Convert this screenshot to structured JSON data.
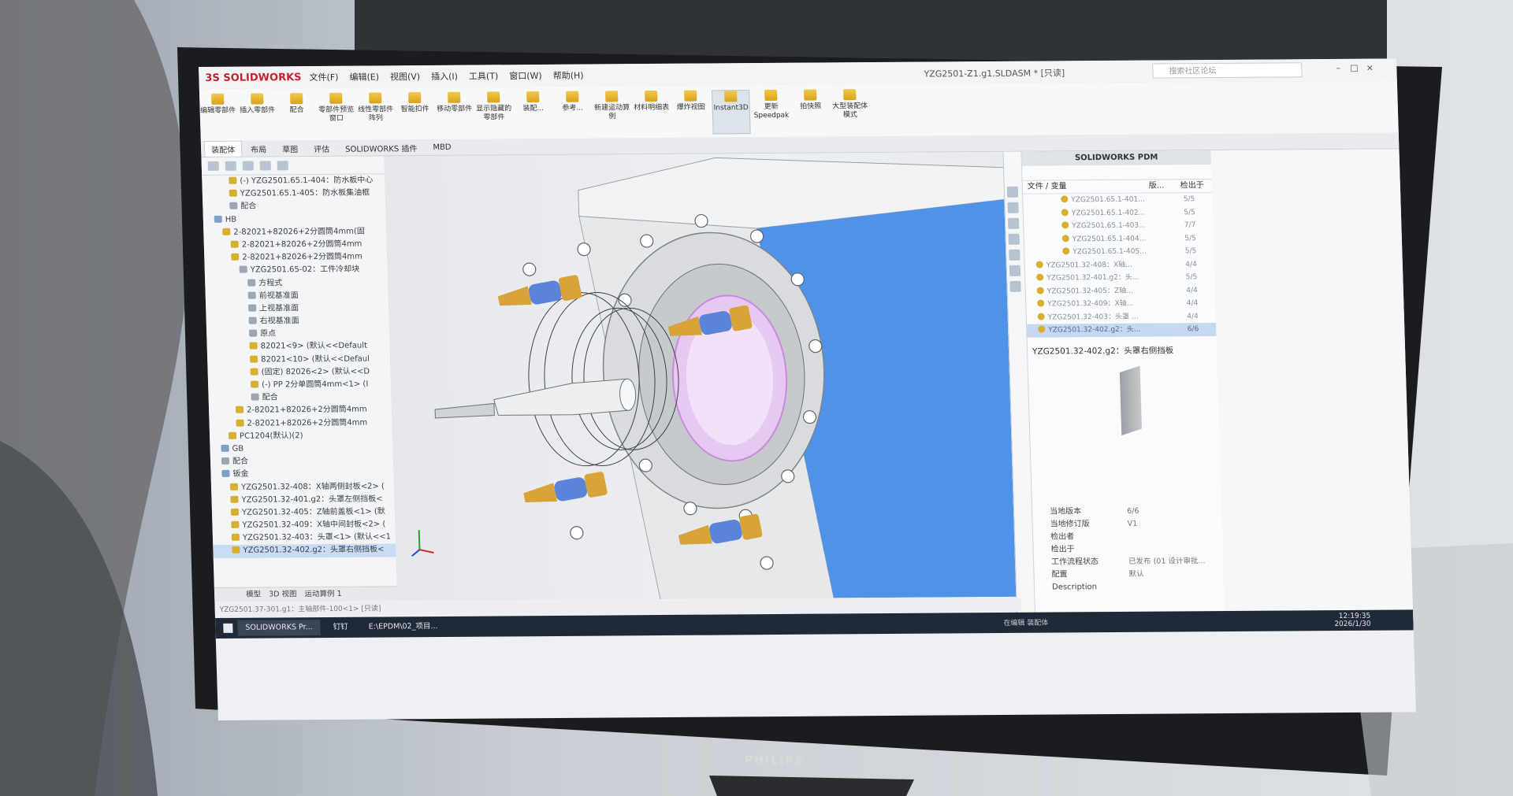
{
  "app": {
    "logo": "3S SOLIDWORKS",
    "menu": [
      "文件(F)",
      "编辑(E)",
      "视图(V)",
      "插入(I)",
      "工具(T)",
      "窗口(W)",
      "帮助(H)"
    ],
    "document_title": "YZG2501-Z1.g1.SLDASM * [只读]",
    "search_placeholder": "搜索社区论坛",
    "ribbon": [
      "编辑零部件",
      "插入零部件",
      "配合",
      "零部件预览窗口",
      "线性零部件阵列",
      "智能扣件",
      "移动零部件",
      "显示隐藏的零部件",
      "装配...",
      "参考...",
      "新建运动算例",
      "材料明细表",
      "爆炸视图",
      "Instant3D",
      "更新Speedpak",
      "拍快照",
      "大型装配体模式"
    ],
    "ribbon_selected": "Instant3D",
    "tabs": [
      "装配体",
      "布局",
      "草图",
      "评估",
      "SOLIDWORKS 插件",
      "MBD"
    ]
  },
  "tree": {
    "nodes": [
      "(-) YZG2501.65.1-404：防水板中心",
      "YZG2501.65.1-405：防水板集油框",
      "配合",
      "HB",
      "2-82021+82026+2分圆筒4mm(固",
      "2-82021+82026+2分圆筒4mm",
      "2-82021+82026+2分圆筒4mm",
      "YZG2501.65-02：工件冷却块",
      "方程式",
      "前视基准面",
      "上视基准面",
      "右视基准面",
      "原点",
      "82021<9> (默认<<Default",
      "82021<10> (默认<<Defaul",
      "(固定) 82026<2> (默认<<D",
      "(-) PP 2分单圆筒4mm<1> (I",
      "配合",
      "2-82021+82026+2分圆筒4mm",
      "2-82021+82026+2分圆筒4mm",
      "PC1204(默认)(2)",
      "GB",
      "配合",
      "钣金",
      "YZG2501.32-408：X轴两侧封板<2> (",
      "YZG2501.32-401.g2：头罩左侧挡板<",
      "YZG2501.32-405：Z轴前盖板<1> (默",
      "YZG2501.32-409：X轴中间封板<2> (",
      "YZG2501.32-403：头罩<1> (默认<<1",
      "YZG2501.32-402.g2：头罩右侧挡板<"
    ],
    "selected_index": 29,
    "bottom_tabs": [
      "模型",
      "3D 视图",
      "运动算例 1"
    ]
  },
  "status_bar": "YZG2501.37-301.g1：主轴部件-100<1> [只读]",
  "pdm": {
    "title": "SOLIDWORKS PDM",
    "col_file": "文件 / 变量",
    "col_version": "版...",
    "col_checked": "检出于",
    "rows": [
      {
        "name": "YZG2501.65.1-401...",
        "ver": "5/5"
      },
      {
        "name": "YZG2501.65.1-402...",
        "ver": "5/5"
      },
      {
        "name": "YZG2501.65.1-403...",
        "ver": "7/7"
      },
      {
        "name": "YZG2501.65.1-404...",
        "ver": "5/5"
      },
      {
        "name": "YZG2501.65.1-405...",
        "ver": "5/5"
      },
      {
        "name": "YZG2501.32-408：X轴...",
        "ver": "4/4"
      },
      {
        "name": "YZG2501.32-401.g2：头...",
        "ver": "5/5"
      },
      {
        "name": "YZG2501.32-405：Z轴...",
        "ver": "4/4"
      },
      {
        "name": "YZG2501.32-409：X轴...",
        "ver": "4/4"
      },
      {
        "name": "YZG2501.32-403：头罩 ...",
        "ver": "4/4"
      },
      {
        "name": "YZG2501.32-402.g2：头...",
        "ver": "6/6"
      }
    ],
    "selected_row": 10,
    "selected_title": "YZG2501.32-402.g2：头罩右侧挡板",
    "props": [
      {
        "label": "当地版本",
        "value": "6/6"
      },
      {
        "label": "当地修订版",
        "value": "V1"
      },
      {
        "label": "检出者",
        "value": ""
      },
      {
        "label": "检出于",
        "value": ""
      },
      {
        "label": "工作流程状态",
        "value": "已发布 (01 设计审批..."
      },
      {
        "label": "配置",
        "value": "默认"
      },
      {
        "label": "Description",
        "value": ""
      }
    ]
  },
  "taskbar": {
    "items": [
      "SOLIDWORKS Pr...",
      "钉钉",
      "E:\\EPDM\\02_项目..."
    ],
    "time": "12:19:35",
    "date": "2026/1/30",
    "status_right": "在编辑 装配体"
  },
  "monitor_brand": "PHILIPS",
  "colors": {
    "solidworks_red": "#c8202f",
    "selection_blue": "#c9dcf3",
    "viewport_plate_blue": "#4f93e8",
    "connector_brass": "#d8a43a",
    "connector_blue": "#5a84d8",
    "seal_magenta": "#d596e8"
  }
}
